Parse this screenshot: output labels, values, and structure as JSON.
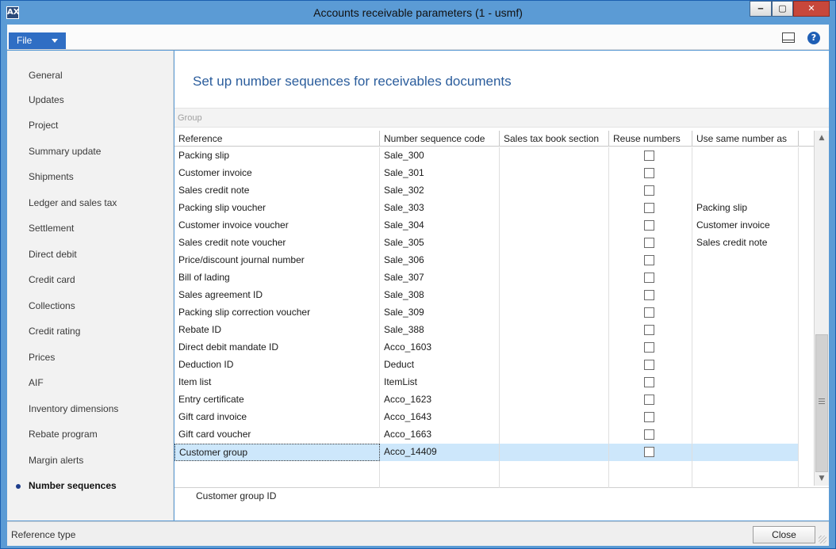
{
  "window": {
    "title": "Accounts receivable parameters (1 - usmf)",
    "icon_label": "AX",
    "minimize_glyph": "‒",
    "maximize_glyph": "▢",
    "close_glyph": "✕"
  },
  "menubar": {
    "file_label": "File",
    "help_glyph": "?"
  },
  "nav": {
    "items": [
      {
        "label": "General"
      },
      {
        "label": "Updates"
      },
      {
        "label": "Project"
      },
      {
        "label": "Summary update"
      },
      {
        "label": "Shipments"
      },
      {
        "label": "Ledger and sales tax"
      },
      {
        "label": "Settlement"
      },
      {
        "label": "Direct debit"
      },
      {
        "label": "Credit card"
      },
      {
        "label": "Collections"
      },
      {
        "label": "Credit rating"
      },
      {
        "label": "Prices"
      },
      {
        "label": "AIF"
      },
      {
        "label": "Inventory dimensions"
      },
      {
        "label": "Rebate program"
      },
      {
        "label": "Margin alerts"
      },
      {
        "label": "Number sequences",
        "active": true
      }
    ]
  },
  "main": {
    "heading": "Set up number sequences for receivables documents",
    "group_label": "Group",
    "columns": [
      "Reference",
      "Number sequence code",
      "Sales tax book section",
      "Reuse numbers",
      "Use same number as"
    ],
    "rows": [
      {
        "reference": "Packing slip",
        "code": "Sale_300",
        "tax_section": "",
        "reuse": false,
        "same_as": ""
      },
      {
        "reference": "Customer invoice",
        "code": "Sale_301",
        "tax_section": "",
        "reuse": false,
        "same_as": ""
      },
      {
        "reference": "Sales credit note",
        "code": "Sale_302",
        "tax_section": "",
        "reuse": false,
        "same_as": ""
      },
      {
        "reference": "Packing slip voucher",
        "code": "Sale_303",
        "tax_section": "",
        "reuse": false,
        "same_as": "Packing slip"
      },
      {
        "reference": "Customer invoice voucher",
        "code": "Sale_304",
        "tax_section": "",
        "reuse": false,
        "same_as": "Customer invoice"
      },
      {
        "reference": "Sales credit note voucher",
        "code": "Sale_305",
        "tax_section": "",
        "reuse": false,
        "same_as": "Sales credit note"
      },
      {
        "reference": "Price/discount journal number",
        "code": "Sale_306",
        "tax_section": "",
        "reuse": false,
        "same_as": ""
      },
      {
        "reference": "Bill of lading",
        "code": "Sale_307",
        "tax_section": "",
        "reuse": false,
        "same_as": ""
      },
      {
        "reference": "Sales agreement ID",
        "code": "Sale_308",
        "tax_section": "",
        "reuse": false,
        "same_as": ""
      },
      {
        "reference": "Packing slip correction voucher",
        "code": "Sale_309",
        "tax_section": "",
        "reuse": false,
        "same_as": ""
      },
      {
        "reference": "Rebate ID",
        "code": "Sale_388",
        "tax_section": "",
        "reuse": false,
        "same_as": ""
      },
      {
        "reference": "Direct debit mandate ID",
        "code": "Acco_1603",
        "tax_section": "",
        "reuse": false,
        "same_as": ""
      },
      {
        "reference": "Deduction ID",
        "code": "Deduct",
        "tax_section": "",
        "reuse": false,
        "same_as": ""
      },
      {
        "reference": "Item list",
        "code": "ItemList",
        "tax_section": "",
        "reuse": false,
        "same_as": ""
      },
      {
        "reference": "Entry certificate",
        "code": "Acco_1623",
        "tax_section": "",
        "reuse": false,
        "same_as": ""
      },
      {
        "reference": "Gift card invoice",
        "code": "Acco_1643",
        "tax_section": "",
        "reuse": false,
        "same_as": ""
      },
      {
        "reference": "Gift card voucher",
        "code": "Acco_1663",
        "tax_section": "",
        "reuse": false,
        "same_as": ""
      },
      {
        "reference": "Customer group",
        "code": "Acco_14409",
        "tax_section": "",
        "reuse": false,
        "same_as": "",
        "selected": true
      }
    ],
    "scroll_up_glyph": "▲",
    "scroll_down_glyph": "▼",
    "description": "Customer group ID"
  },
  "statusbar": {
    "text": "Reference type",
    "close_label": "Close"
  },
  "colors": {
    "title_bar": "#5b9bd5",
    "file_button": "#2f6ec4",
    "heading": "#2b5d9c",
    "selected_row": "#cde7fb",
    "close_button_red": "#c7473b"
  }
}
